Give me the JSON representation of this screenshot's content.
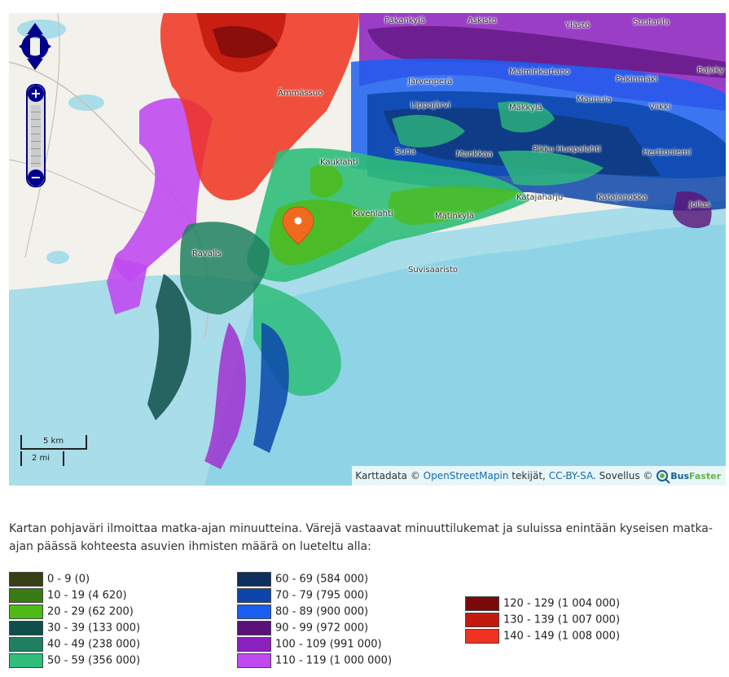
{
  "map": {
    "places": [
      {
        "id": "pakankyla",
        "label": "Pakankylä"
      },
      {
        "id": "askisto",
        "label": "Askisto"
      },
      {
        "id": "ylasto",
        "label": "Ylästö"
      },
      {
        "id": "suutarila",
        "label": "Suutarila"
      },
      {
        "id": "ammassuo",
        "label": "Ämmässuo"
      },
      {
        "id": "jarvenpera",
        "label": "Järvenperä"
      },
      {
        "id": "malminkartano",
        "label": "Malminkartano"
      },
      {
        "id": "pukinmaki",
        "label": "Pukinmäki"
      },
      {
        "id": "rajakyla",
        "label": "Rajaky"
      },
      {
        "id": "lippajarvi",
        "label": "Lippajärvi"
      },
      {
        "id": "maunula",
        "label": "Maunula"
      },
      {
        "id": "makkyla",
        "label": "Mäkkylä"
      },
      {
        "id": "viikki",
        "label": "Viikki"
      },
      {
        "id": "suna",
        "label": "Suna"
      },
      {
        "id": "mankkaa",
        "label": "Mankkaa"
      },
      {
        "id": "pikkuhuopalahti",
        "label": "Pikku Huopalahti"
      },
      {
        "id": "herttoniemi",
        "label": "Herttoniemi"
      },
      {
        "id": "kauklahti",
        "label": "Kauklahti"
      },
      {
        "id": "katajaharju",
        "label": "Katajaharju"
      },
      {
        "id": "katajanokka",
        "label": "Katajanokka"
      },
      {
        "id": "jollas",
        "label": "Jollas"
      },
      {
        "id": "kivenlahti",
        "label": "Kivenlahti"
      },
      {
        "id": "matinkyla",
        "label": "Matinkylä"
      },
      {
        "id": "ravalls",
        "label": "Ravalls"
      },
      {
        "id": "suvisaaristo",
        "label": "Suvisaaristo"
      }
    ],
    "controls": {
      "zoom_in": "+",
      "zoom_out": "−"
    },
    "scale": {
      "km_label": "5 km",
      "mi_label": "2 mi"
    },
    "attribution": {
      "prefix": "Karttadata ©",
      "osm_link": "OpenStreetMapin",
      "middle": "tekijät,",
      "license_link": "CC-BY-SA",
      "suffix": ". Sovellus ©",
      "brand_bus": "Bus",
      "brand_faster": "Faster"
    },
    "marker_color": "#f06a1e"
  },
  "description": "Kartan pohjaväri ilmoittaa matka-ajan minuutteina. Värejä vastaavat minuuttilukemat ja suluissa enintään kyseisen matka-ajan päässä kohteesta asuvien ihmisten määrä on lueteltu alla:",
  "legend": [
    {
      "label": "0 - 9 (0)",
      "color": "#364012"
    },
    {
      "label": "10 - 19 (4 620)",
      "color": "#3a7a12"
    },
    {
      "label": "20 - 29 (62 200)",
      "color": "#4cbb17"
    },
    {
      "label": "30 - 39 (133 000)",
      "color": "#0f4f4a"
    },
    {
      "label": "40 - 49 (238 000)",
      "color": "#1e8060"
    },
    {
      "label": "50 - 59 (356 000)",
      "color": "#2fbd7a"
    },
    {
      "label": "60 - 69 (584 000)",
      "color": "#0c2f5e"
    },
    {
      "label": "70 - 79 (795 000)",
      "color": "#0c46aa"
    },
    {
      "label": "80 - 89 (900 000)",
      "color": "#1a5ff0"
    },
    {
      "label": "90 - 99 (972 000)",
      "color": "#5a1278"
    },
    {
      "label": "100 - 109 (991 000)",
      "color": "#8b1fc0"
    },
    {
      "label": "110 - 119 (1 000 000)",
      "color": "#c04af0"
    },
    {
      "label": "120 - 129 (1 004 000)",
      "color": "#7a0a0a"
    },
    {
      "label": "130 - 139 (1 007 000)",
      "color": "#c41a0e"
    },
    {
      "label": "140 - 149 (1 008 000)",
      "color": "#f03220"
    }
  ]
}
